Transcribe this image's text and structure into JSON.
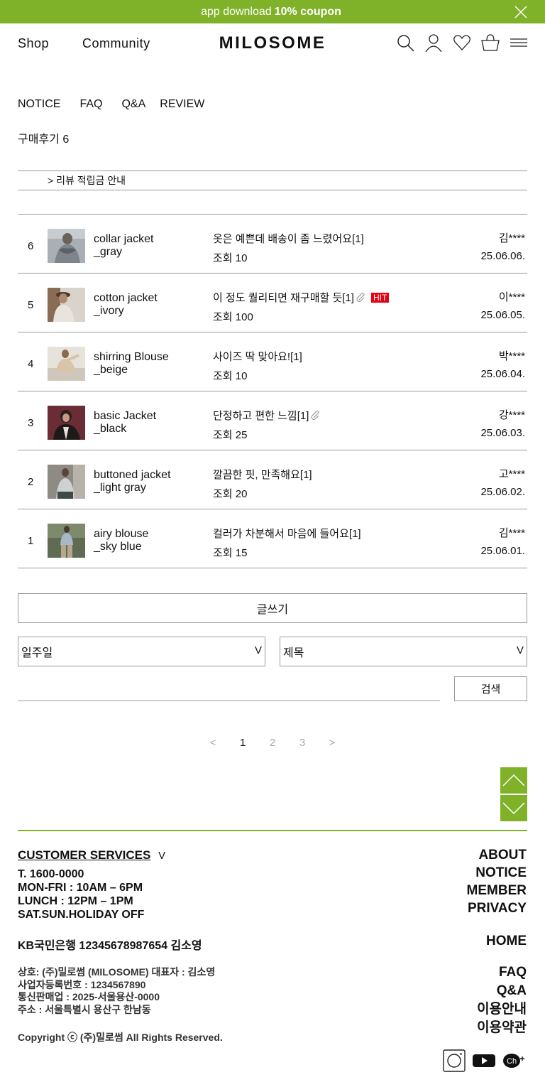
{
  "banner": {
    "text_before": "app download",
    "highlight": "10% coupon",
    "close_icon": "close-icon"
  },
  "header": {
    "nav": [
      "Shop",
      "Community"
    ],
    "logo": "MILOSOME",
    "icons": [
      "search-icon",
      "user-icon",
      "heart-icon",
      "cart-icon",
      "menu-icon"
    ]
  },
  "board": {
    "tabs": [
      "NOTICE",
      "FAQ",
      "Q&A",
      "REVIEW"
    ],
    "title": "구매후기 6",
    "notice": "> 리뷰 적립금 안내"
  },
  "reviews": [
    {
      "num": "6",
      "product": "collar jacket",
      "option": "_gray",
      "subject": "옷은 예쁜데 배송이 좀 느렸어요[1]",
      "views": "조회 10",
      "author": "김****",
      "date": "25.06.06.",
      "attachment": false,
      "hit": ""
    },
    {
      "num": "5",
      "product": "cotton jacket",
      "option": "_ivory",
      "subject": "이 정도 퀄리티면 재구매할 듯[1]",
      "views": "조회 100",
      "author": "이****",
      "date": "25.06.05.",
      "attachment": true,
      "hit": "HIT"
    },
    {
      "num": "4",
      "product": "shirring Blouse",
      "option": "_beige",
      "subject": "사이즈 딱 맞아요![1]",
      "views": "조회 10",
      "author": "박****",
      "date": "25.06.04.",
      "attachment": false,
      "hit": ""
    },
    {
      "num": "3",
      "product": "basic Jacket",
      "option": "_black",
      "subject": "단정하고 편한 느낌[1]",
      "views": "조회 25",
      "author": "강****",
      "date": "25.06.03.",
      "attachment": true,
      "hit": ""
    },
    {
      "num": "2",
      "product": "buttoned jacket",
      "option": "_light gray",
      "subject": "깔끔한 핏, 만족해요[1]",
      "views": "조회 20",
      "author": "고****",
      "date": "25.06.02.",
      "attachment": false,
      "hit": ""
    },
    {
      "num": "1",
      "product": "airy blouse",
      "option": "_sky blue",
      "subject": "컬러가 차분해서 마음에 들어요[1]",
      "views": "조회 15",
      "author": "김****",
      "date": "25.06.01.",
      "attachment": false,
      "hit": ""
    }
  ],
  "controls": {
    "write_label": "글쓰기",
    "period_select": "일주일",
    "field_select": "제목",
    "chevron": "V",
    "search_label": "검색",
    "search_value": ""
  },
  "pagination": {
    "prev": "<",
    "pages": [
      "1",
      "2",
      "3"
    ],
    "next": ">",
    "current": "1"
  },
  "footer": {
    "cs_title": "CUSTOMER SERVICES",
    "cs_chevron": "V",
    "phone": "T. 1600-0000",
    "hours": "MON-FRI : 10AM – 6PM",
    "lunch": "LUNCH : 12PM – 1PM",
    "holiday": "SAT.SUN.HOLIDAY OFF",
    "bank": "KB국민은행 12345678987654 김소영",
    "company_name": "상호: (주)밀로썸 (MILOSOME)  대표자 : 김소영",
    "biz_no": "사업자등록번호 : 1234567890",
    "mail_order": "통신판매업 : 2025-서울용산-0000",
    "address": "주소 : 서울특별시 용산구 한남동",
    "copyright": "Copyright ⓒ (주)밀로썸 All Rights Reserved.",
    "nav_group1": [
      "ABOUT",
      "NOTICE",
      "MEMBER",
      "PRIVACY"
    ],
    "nav_home": "HOME",
    "nav_group2": [
      "FAQ",
      "Q&A",
      "이용안내",
      "이용약관"
    ],
    "social": [
      "instagram-icon",
      "youtube-icon",
      "channel-talk-icon"
    ]
  },
  "colors": {
    "accent": "#7fb229",
    "hit": "#e60012",
    "border": "#999999"
  }
}
